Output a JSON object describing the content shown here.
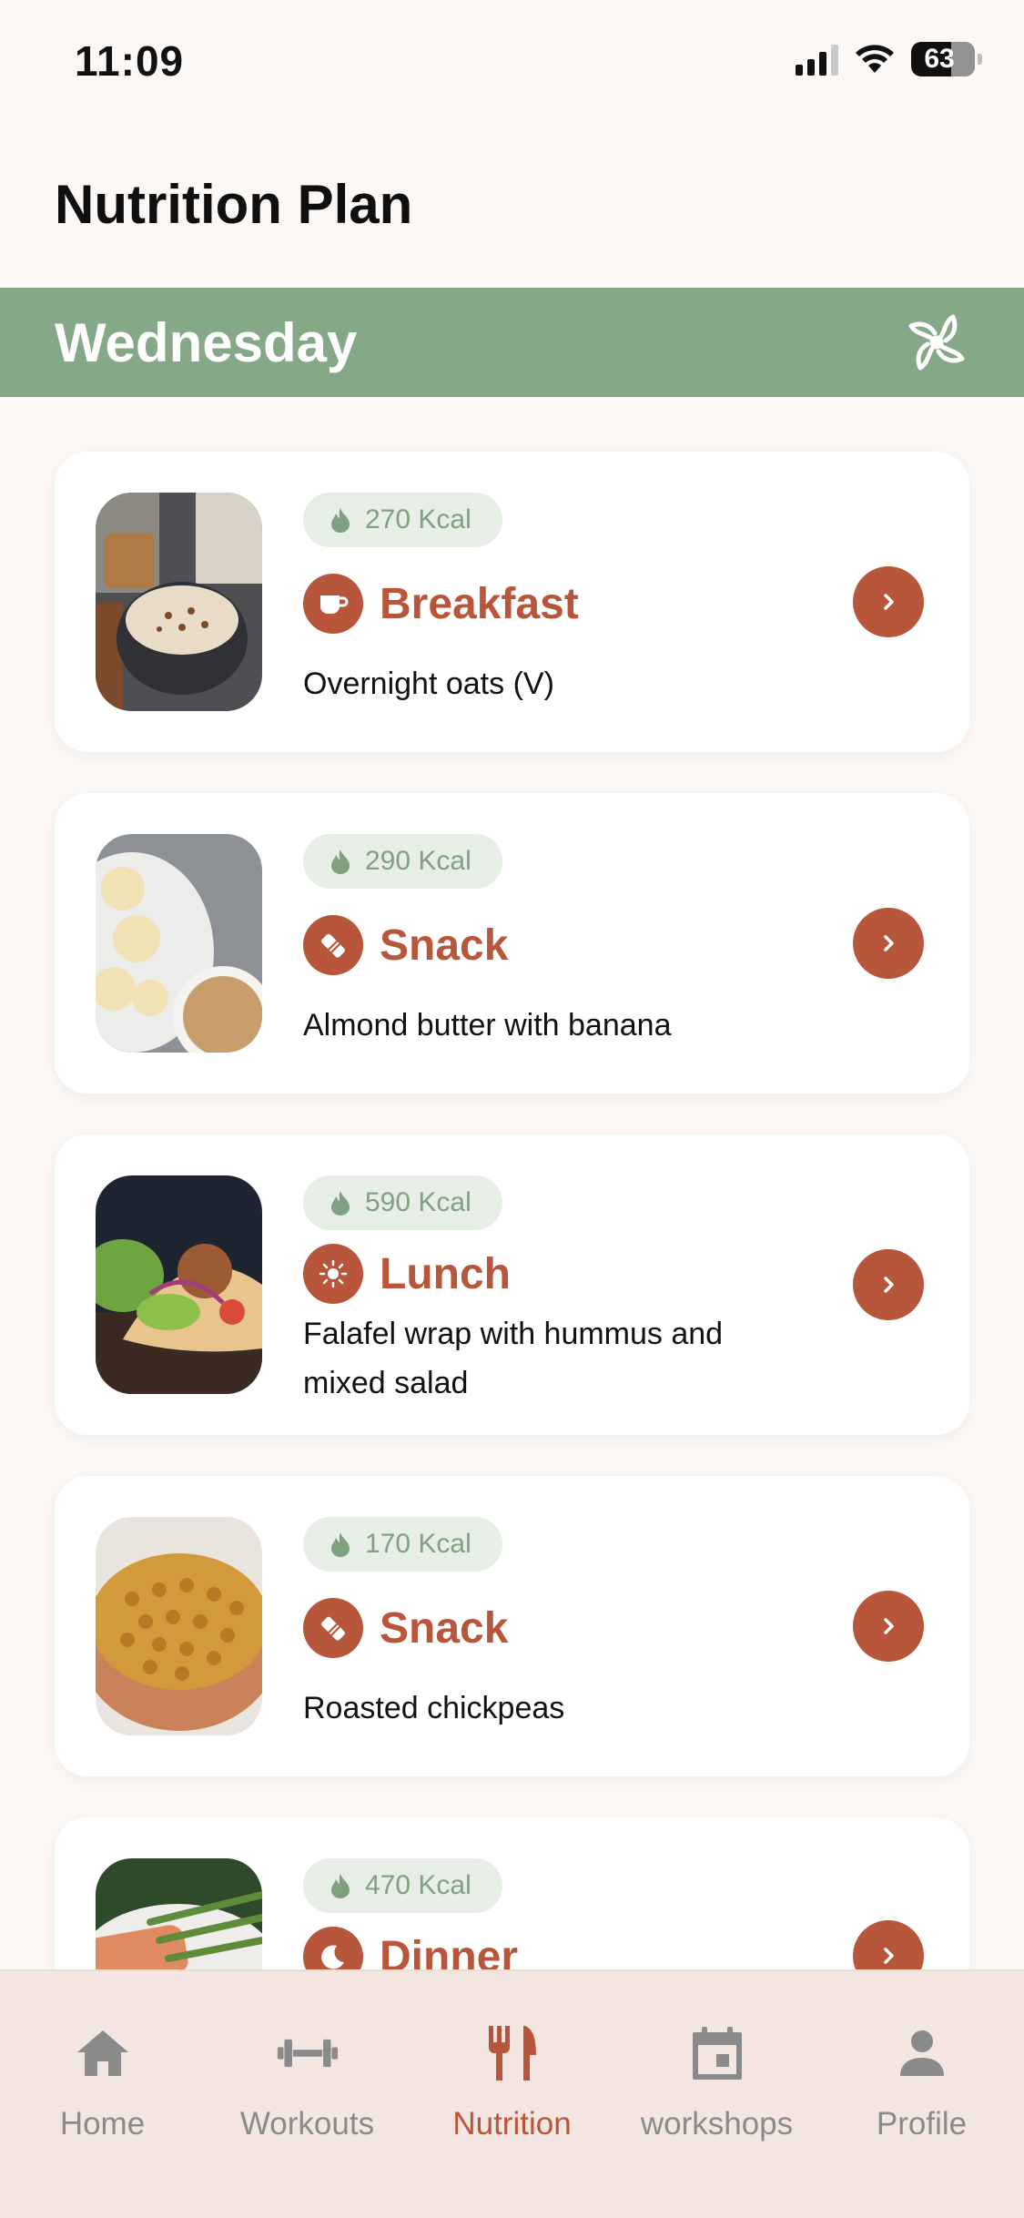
{
  "status_bar": {
    "time": "11:09",
    "battery": "63",
    "icons": [
      "cellular-signal-icon",
      "wifi-icon",
      "battery-icon"
    ]
  },
  "header": {
    "title": "Nutrition Plan"
  },
  "day_banner": {
    "day": "Wednesday",
    "logo_icon": "brand-logo-icon",
    "background": "#85A886"
  },
  "meals": [
    {
      "kcal": "270 Kcal",
      "type": "Breakfast",
      "type_icon": "coffee-cup-icon",
      "description": "Overnight oats (V)",
      "image": "overnight-oats-photo"
    },
    {
      "kcal": "290 Kcal",
      "type": "Snack",
      "type_icon": "snack-bar-icon",
      "description": "Almond butter with banana",
      "image": "almond-butter-banana-photo"
    },
    {
      "kcal": "590 Kcal",
      "type": "Lunch",
      "type_icon": "sun-icon",
      "description": "Falafel wrap with hummus and mixed salad",
      "image": "falafel-wrap-photo"
    },
    {
      "kcal": "170 Kcal",
      "type": "Snack",
      "type_icon": "snack-bar-icon",
      "description": "Roasted chickpeas",
      "image": "roasted-chickpeas-photo"
    },
    {
      "kcal": "470 Kcal",
      "type": "Dinner",
      "type_icon": "moon-icon",
      "description": "",
      "image": "salmon-asparagus-photo"
    }
  ],
  "tab_bar": {
    "active": "Nutrition",
    "tabs": [
      {
        "label": "Home",
        "icon": "home-icon"
      },
      {
        "label": "Workouts",
        "icon": "dumbbell-icon"
      },
      {
        "label": "Nutrition",
        "icon": "fork-knife-icon"
      },
      {
        "label": "workshops",
        "icon": "calendar-icon"
      },
      {
        "label": "Profile",
        "icon": "person-icon"
      }
    ]
  },
  "colors": {
    "accent": "#B8563B",
    "kcal_pill_bg": "#E6EEE6",
    "kcal_text": "#7FA181",
    "page_bg": "#FCF8F5",
    "tab_bar_bg": "#F3E6E0",
    "inactive_tab": "#8A8A8A"
  }
}
